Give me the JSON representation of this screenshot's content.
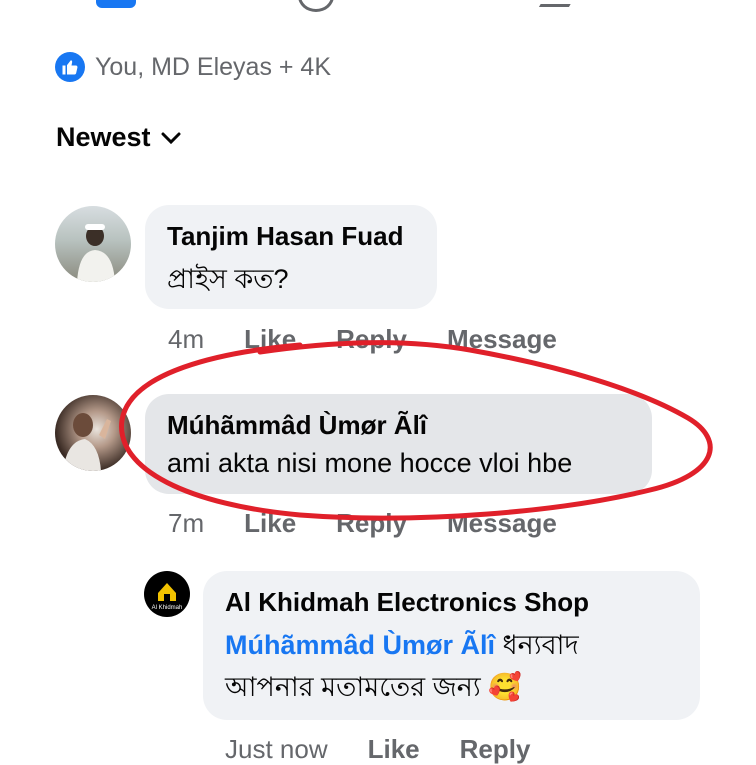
{
  "reactions": {
    "text": "You, MD Eleyas + 4K",
    "icon": "like-icon",
    "color": "#1877f2"
  },
  "sort": {
    "label": "Newest",
    "icon": "chevron-down-icon"
  },
  "comments": [
    {
      "author": "Tanjim Hasan Fuad",
      "text": "প্রাইস কত?",
      "time": "4m",
      "actions": [
        "Like",
        "Reply",
        "Message"
      ]
    },
    {
      "author": "Múhãmmâd Ùmør Ãlî",
      "text": "ami akta nisi mone hocce vloi hbe",
      "time": "7m",
      "actions": [
        "Like",
        "Reply",
        "Message"
      ]
    }
  ],
  "reply": {
    "author": "Al Khidmah Electronics Shop",
    "tag": "Múhãmmâd Ùmør Ãlî",
    "text_line1": "ধন্যবাদ",
    "text_line2": "আপনার মতামতের জন্য",
    "emoji": "🥰",
    "avatar_text": "Al Khidmah",
    "time": "Just now",
    "actions": [
      "Like",
      "Reply"
    ]
  },
  "colors": {
    "accent": "#1877f2",
    "annotation": "#e0202a",
    "bubble": "#f0f2f5"
  }
}
